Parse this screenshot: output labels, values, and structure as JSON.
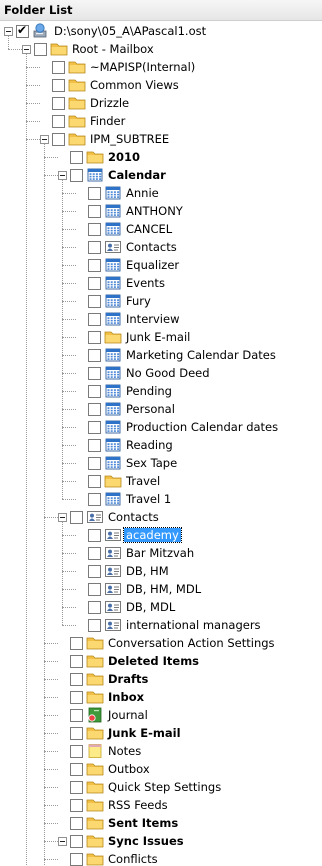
{
  "header": {
    "title": "Folder List"
  },
  "tree": {
    "root_file": "D:\\sony\\05_A\\APascal1.ost",
    "root_mailbox": "Root - Mailbox",
    "items": [
      {
        "label": "~MAPISP(Internal)",
        "icon": "folder-icon",
        "bold": false
      },
      {
        "label": "Common Views",
        "icon": "folder-icon",
        "bold": false
      },
      {
        "label": "Drizzle",
        "icon": "folder-icon",
        "bold": false
      },
      {
        "label": "Finder",
        "icon": "folder-icon",
        "bold": false
      },
      {
        "label": "IPM_SUBTREE",
        "icon": "folder-icon",
        "bold": false
      },
      {
        "label": "2010",
        "icon": "folder-icon",
        "bold": true
      },
      {
        "label": "Calendar",
        "icon": "calendar-icon",
        "bold": true
      },
      {
        "label": "Annie",
        "icon": "calendar-icon",
        "bold": false
      },
      {
        "label": "ANTHONY",
        "icon": "calendar-icon",
        "bold": false
      },
      {
        "label": "CANCEL",
        "icon": "calendar-icon",
        "bold": false
      },
      {
        "label": "Contacts",
        "icon": "contact-card-icon",
        "bold": false
      },
      {
        "label": "Equalizer",
        "icon": "calendar-icon",
        "bold": false
      },
      {
        "label": "Events",
        "icon": "calendar-icon",
        "bold": false
      },
      {
        "label": "Fury",
        "icon": "calendar-icon",
        "bold": false
      },
      {
        "label": "Interview",
        "icon": "calendar-icon",
        "bold": false
      },
      {
        "label": "Junk E-mail",
        "icon": "folder-icon",
        "bold": false
      },
      {
        "label": "Marketing Calendar Dates",
        "icon": "calendar-icon",
        "bold": false
      },
      {
        "label": "No Good Deed",
        "icon": "calendar-icon",
        "bold": false
      },
      {
        "label": "Pending",
        "icon": "calendar-icon",
        "bold": false
      },
      {
        "label": "Personal",
        "icon": "calendar-icon",
        "bold": false
      },
      {
        "label": "Production Calendar dates",
        "icon": "calendar-icon",
        "bold": false
      },
      {
        "label": "Reading",
        "icon": "calendar-icon",
        "bold": false
      },
      {
        "label": "Sex Tape",
        "icon": "calendar-icon",
        "bold": false
      },
      {
        "label": "Travel",
        "icon": "folder-icon",
        "bold": false
      },
      {
        "label": "Travel 1",
        "icon": "calendar-icon",
        "bold": false
      },
      {
        "label": "Contacts",
        "icon": "contact-card-icon",
        "bold": false
      },
      {
        "label": "academy",
        "icon": "contact-card-icon",
        "bold": false,
        "selected": true
      },
      {
        "label": "Bar Mitzvah",
        "icon": "contact-card-icon",
        "bold": false
      },
      {
        "label": "DB, HM",
        "icon": "contact-card-icon",
        "bold": false
      },
      {
        "label": "DB, HM, MDL",
        "icon": "contact-card-icon",
        "bold": false
      },
      {
        "label": "DB, MDL",
        "icon": "contact-card-icon",
        "bold": false
      },
      {
        "label": "international managers",
        "icon": "contact-card-icon",
        "bold": false
      },
      {
        "label": "Conversation Action Settings",
        "icon": "folder-icon",
        "bold": false
      },
      {
        "label": "Deleted Items",
        "icon": "folder-icon",
        "bold": true
      },
      {
        "label": "Drafts",
        "icon": "folder-icon",
        "bold": true
      },
      {
        "label": "Inbox",
        "icon": "folder-icon",
        "bold": true
      },
      {
        "label": "Journal",
        "icon": "journal-icon",
        "bold": false
      },
      {
        "label": "Junk E-mail",
        "icon": "folder-icon",
        "bold": true
      },
      {
        "label": "Notes",
        "icon": "notes-icon",
        "bold": false
      },
      {
        "label": "Outbox",
        "icon": "folder-icon",
        "bold": false
      },
      {
        "label": "Quick Step Settings",
        "icon": "folder-icon",
        "bold": false
      },
      {
        "label": "RSS Feeds",
        "icon": "folder-icon",
        "bold": false
      },
      {
        "label": "Sent Items",
        "icon": "folder-icon",
        "bold": true
      },
      {
        "label": "Sync Issues",
        "icon": "folder-icon",
        "bold": true
      },
      {
        "label": "Conflicts",
        "icon": "folder-icon",
        "bold": false
      }
    ]
  },
  "colors": {
    "folder": "#f5c84a",
    "calendar": "#2f73c9",
    "selection": "#3399ff"
  }
}
